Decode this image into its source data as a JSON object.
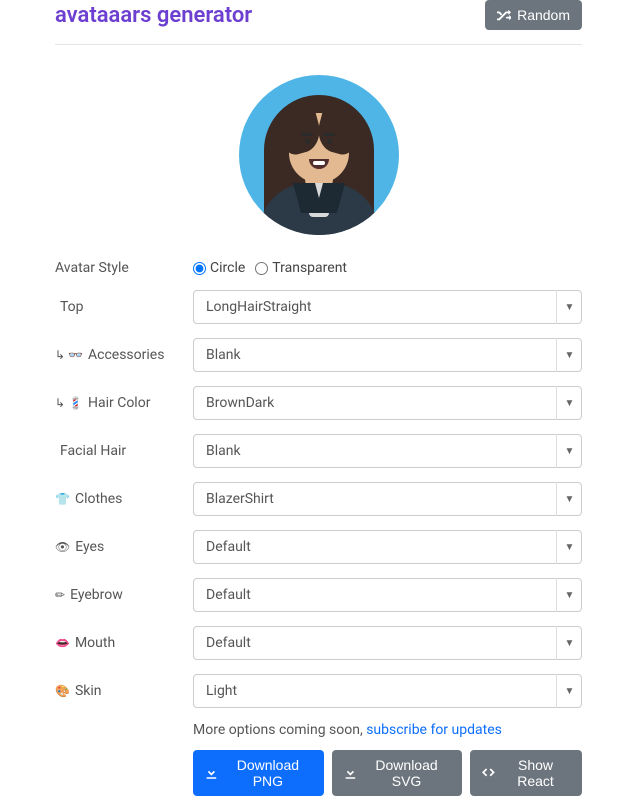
{
  "header": {
    "title": "avataaars generator",
    "random_label": "Random"
  },
  "options": {
    "avatar_style": {
      "label": "Avatar Style",
      "circle": "Circle",
      "transparent": "Transparent",
      "selected": "circle"
    },
    "top": {
      "label": "Top",
      "value": "LongHairStraight",
      "icon": ""
    },
    "accessories": {
      "label": "Accessories",
      "value": "Blank",
      "icon": "↳ 👓"
    },
    "hair_color": {
      "label": "Hair Color",
      "value": "BrownDark",
      "icon": "↳ 💈"
    },
    "facial_hair": {
      "label": "Facial Hair",
      "value": "Blank",
      "icon": ""
    },
    "clothes": {
      "label": "Clothes",
      "value": "BlazerShirt",
      "icon": "👕"
    },
    "eyes": {
      "label": "Eyes",
      "value": "Default",
      "icon": "👁"
    },
    "eyebrow": {
      "label": "Eyebrow",
      "value": "Default",
      "icon": "✏"
    },
    "mouth": {
      "label": "Mouth",
      "value": "Default",
      "icon": "👄"
    },
    "skin": {
      "label": "Skin",
      "value": "Light",
      "icon": "🎨"
    }
  },
  "footer": {
    "text_before": "More options coming soon, ",
    "link": "subscribe for updates",
    "download_png": "Download PNG",
    "download_svg": "Download SVG",
    "show_react": "Show React"
  }
}
